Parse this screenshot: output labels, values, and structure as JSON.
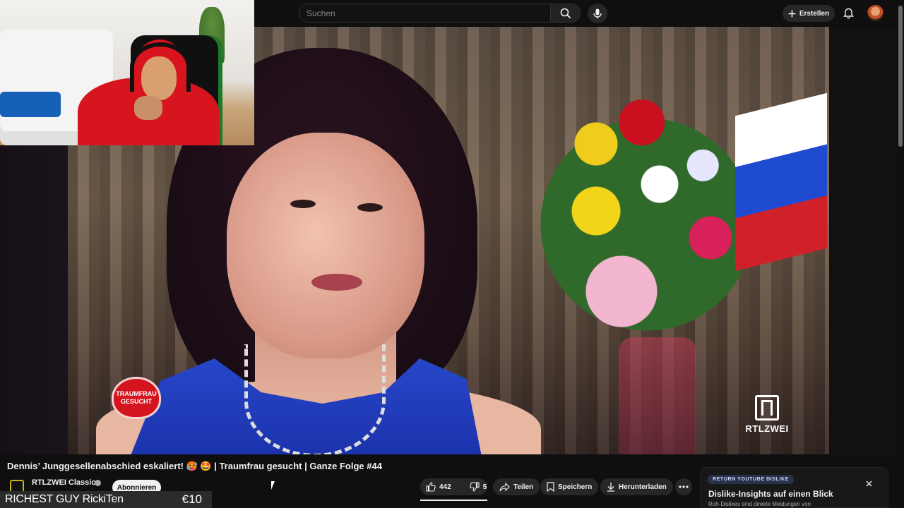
{
  "search": {
    "placeholder": "Suchen"
  },
  "header": {
    "create_label": "Erstellen"
  },
  "video": {
    "title": "Dennis’ Junggesellenabschied eskaliert! 🥵 🤩 | Traumfrau gesucht | Ganze Folge #44",
    "show_logo_text": "TRAUMFRAU GESUCHT",
    "broadcaster_logo_text": "RTLZWEI"
  },
  "channel": {
    "name": "RTLZWEI Classics",
    "subscribe_label": "Abonnieren"
  },
  "actions": {
    "likes": "442",
    "dislikes": "5",
    "share_label": "Teilen",
    "save_label": "Speichern",
    "download_label": "Herunterladen"
  },
  "donation": {
    "name": "RICHEST GUY RickiTen",
    "amount": "€10"
  },
  "dislike_panel": {
    "tag": "RETURN YOUTUBE DISLIKE",
    "heading": "Dislike-Insights auf einen Blick",
    "subtext": "Roh-Dislikes sind direkte Meldungen von"
  },
  "icons": {
    "search": "search-icon",
    "mic": "mic-icon",
    "create": "plus-icon",
    "bell": "bell-icon",
    "like": "thumbs-up-icon",
    "dislike": "thumbs-down-icon",
    "share": "share-icon",
    "save": "bookmark-icon",
    "download": "download-icon",
    "more": "more-icon",
    "close": "close-icon"
  }
}
